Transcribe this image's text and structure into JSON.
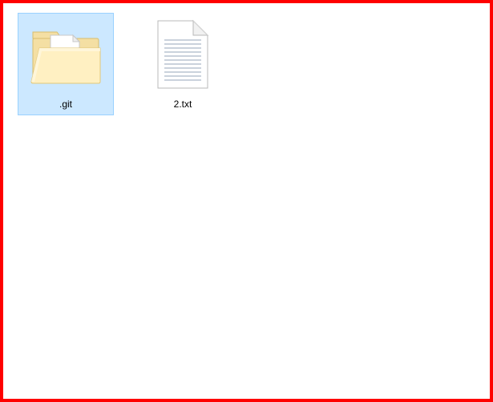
{
  "items": [
    {
      "name": ".git",
      "type": "folder-with-file",
      "selected": true
    },
    {
      "name": "2.txt",
      "type": "text-file",
      "selected": false
    }
  ]
}
